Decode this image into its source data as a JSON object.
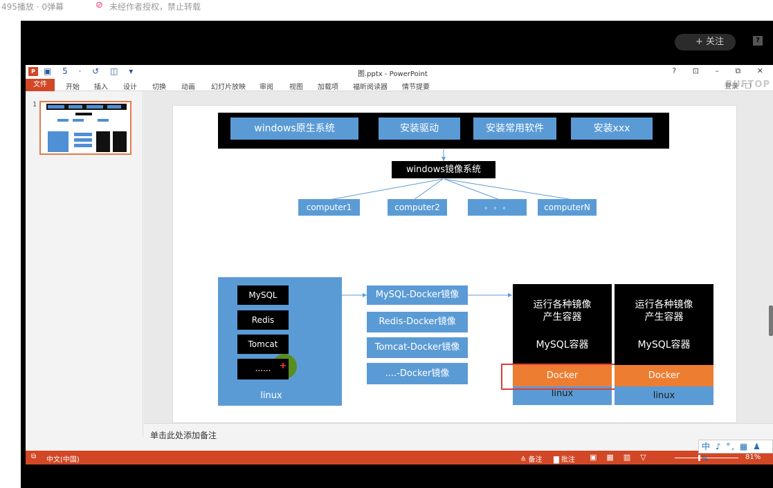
{
  "info": {
    "views": "495播放 · 0弹幕",
    "noauth": "未经作者授权，禁止转载"
  },
  "player": {
    "follow_label": "+ 关注",
    "report_label": "?"
  },
  "ppt": {
    "title": "图.pptx - PowerPoint",
    "logo": "P",
    "qat": "▣ 5 · ↺ ◫ ▾",
    "window_controls": "? ⊡ – ⧉ ✕",
    "brand": "BUFTOP",
    "tabs": [
      "文件",
      "开始",
      "插入",
      "设计",
      "切换",
      "动画",
      "幻灯片放映",
      "审阅",
      "视图",
      "加载项",
      "福昕阅读器",
      "情节提要"
    ],
    "user": "登录 · ☐",
    "thumb_number": "1",
    "notes_placeholder": "单击此处添加备注",
    "status": {
      "language": "中文(中国)",
      "notes": "≙ 备注",
      "comments": "▇ 批注",
      "zoom": "81%"
    },
    "ime": "中 ♪ °, ▦ ♟ ✎"
  },
  "slide": {
    "top_row": [
      "windows原生系统",
      "安装驱动",
      "安装常用软件",
      "安装xxx"
    ],
    "image_system": "windows镜像系统",
    "computers": [
      "computer1",
      "computer2",
      "。 。 。",
      "computerN"
    ],
    "linux_apps": [
      "MySQL",
      "Redis",
      "Tomcat",
      "......"
    ],
    "linux_label": "linux",
    "plus": "+",
    "docker_images": [
      "MySQL-Docker镜像",
      "Redis-Docker镜像",
      "Tomcat-Docker镜像",
      "....-Docker镜像"
    ],
    "containers": [
      {
        "title": "运行各种镜像\n产生容器",
        "sub": "MySQL容器",
        "docker": "Docker",
        "linux": "linux"
      },
      {
        "title": "运行各种镜像\n产生容器",
        "sub": "MySQL容器",
        "docker": "Docker",
        "linux": "linux"
      }
    ]
  },
  "colors": {
    "box_blue": "#5b9bd5",
    "docker_orange": "#ed7d31",
    "ppt_orange": "#d24726",
    "highlight_red": "#e03b3b"
  }
}
